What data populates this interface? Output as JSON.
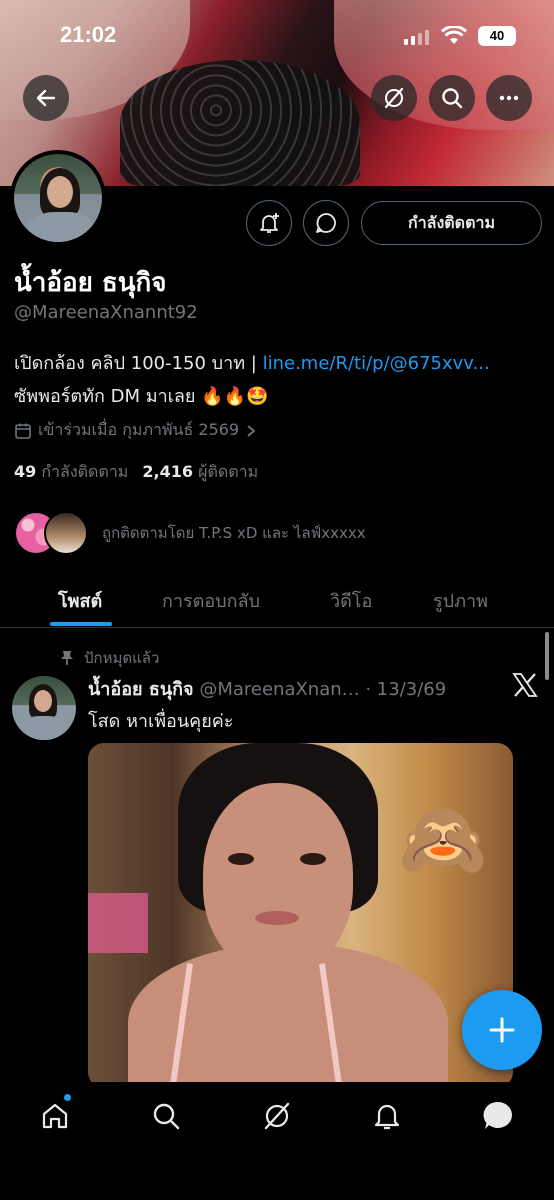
{
  "status_bar": {
    "time": "21:02",
    "battery": "40"
  },
  "header_actions": {
    "back": "back-arrow-icon",
    "grok": "grok-icon",
    "search": "search-icon",
    "more": "more-icon"
  },
  "profile": {
    "display_name": "น้ำอ้อย ธนุกิจ",
    "handle": "@MareenaXnannt92",
    "bio_line1_text": "เปิดกล้อง คลิป 100-150 บาท | ",
    "bio_line1_link": "line.me/R/ti/p/@675xvv...",
    "bio_line2": "ซัพพอร์ตทัก DM มาเลย 🔥🔥🤩",
    "joined": "เข้าร่วมเมื่อ กุมภาพันธ์ 2569",
    "following_count": "49",
    "following_label": "กำลังติดตาม",
    "followers_count": "2,416",
    "followers_label": "ผู้ติดตาม",
    "followed_by": "ถูกติดตามโดย T.P.S xD และ ไลฟ์xxxxx",
    "follow_button": "กำลังติดตาม"
  },
  "tabs": [
    {
      "label": "โพสต์",
      "active": true
    },
    {
      "label": "การตอบกลับ",
      "active": false
    },
    {
      "label": "วิดีโอ",
      "active": false
    },
    {
      "label": "รูปภาพ",
      "active": false
    }
  ],
  "post": {
    "pinned_label": "ปักหมุดแล้ว",
    "author_name": "น้ำอ้อย ธนุกิจ",
    "author_handle_date": " @MareenaXnan… · 13/3/69",
    "text": "โสด หาเพื่อนคุยค่ะ",
    "emoji": "🙈"
  },
  "colors": {
    "accent": "#1d9bf0",
    "background": "#000000",
    "secondary_text": "#71767b",
    "primary_text": "#e7e9ea"
  },
  "bottom_nav": [
    "home-icon",
    "search-icon",
    "grok-icon",
    "notifications-icon",
    "messages-icon"
  ]
}
